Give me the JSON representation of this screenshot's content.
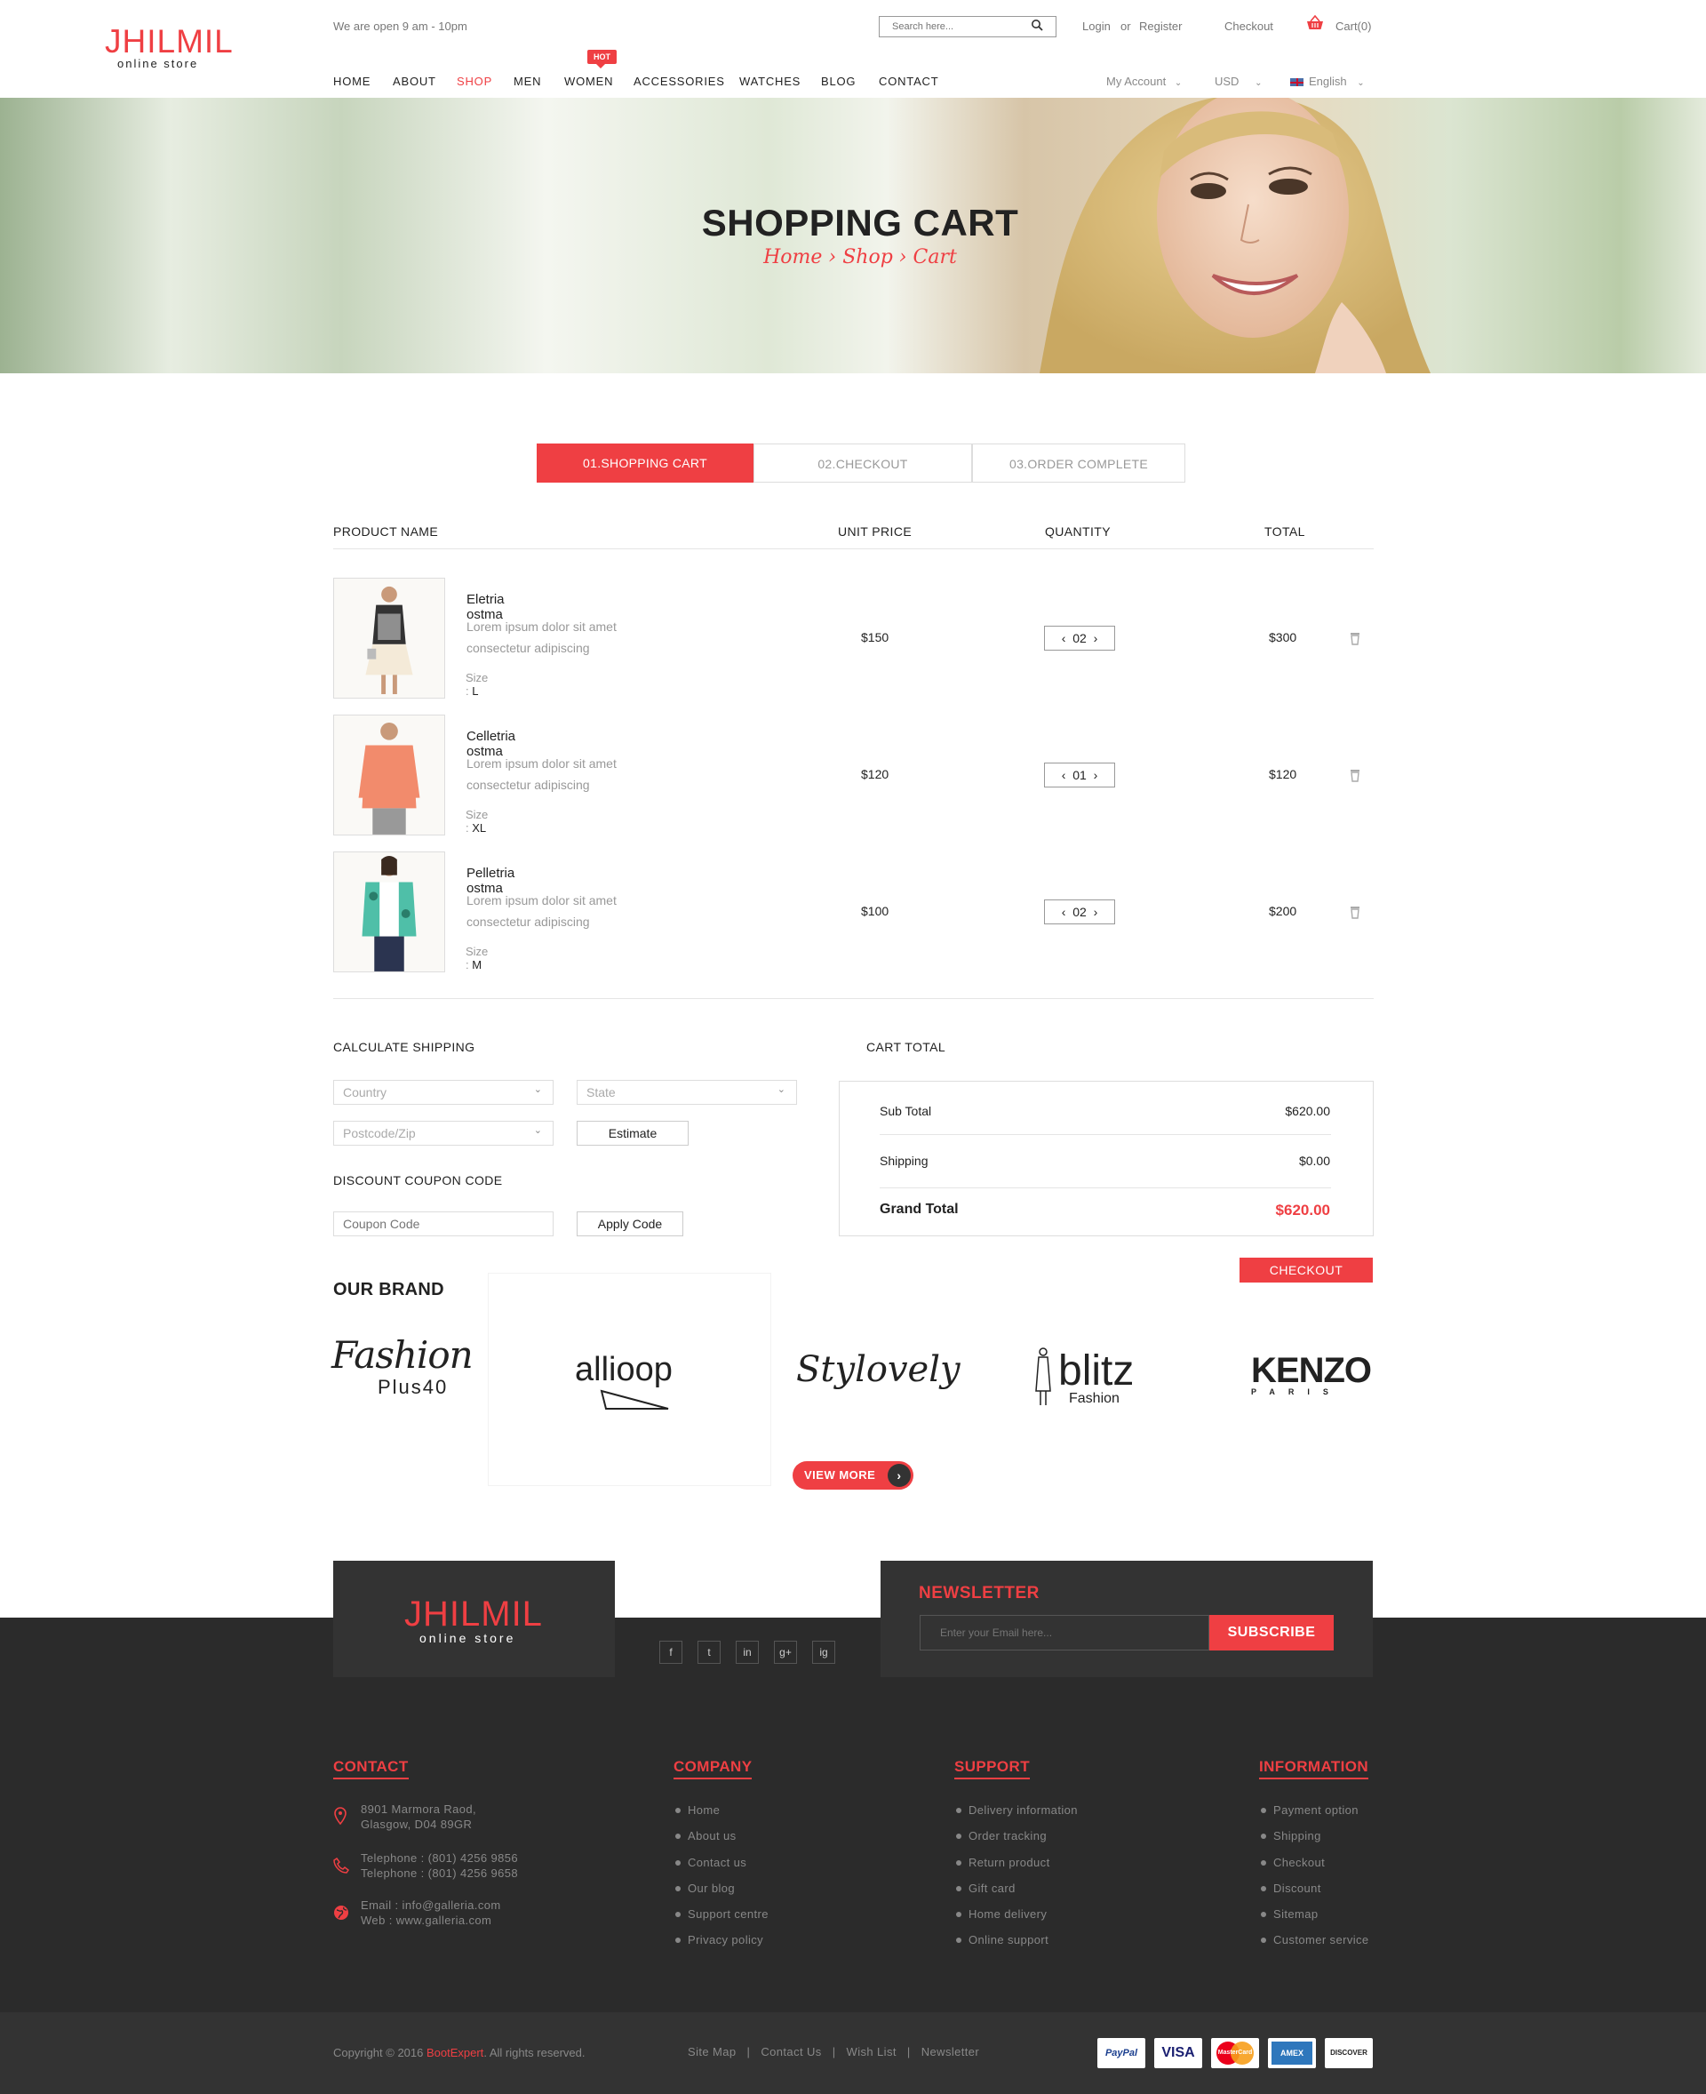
{
  "header": {
    "logo_main": "JHILMIL",
    "logo_sub": "online store",
    "open_hours": "We are open 9 am - 10pm",
    "search_placeholder": "Search here...",
    "login": "Login",
    "or": "or",
    "register": "Register",
    "checkout": "Checkout",
    "cart": "Cart(0)",
    "hot_badge": "HOT",
    "nav": [
      "HOME",
      "ABOUT",
      "SHOP",
      "MEN",
      "WOMEN",
      "ACCESSORIES",
      "WATCHES",
      "BLOG",
      "CONTACT"
    ],
    "my_account": "My Account",
    "currency": "USD",
    "language": "English"
  },
  "banner": {
    "title": "SHOPPING CART",
    "breadcrumb": "Home › Shop › Cart"
  },
  "steps": [
    "01.SHOPPING CART",
    "02.CHECKOUT",
    "03.ORDER COMPLETE"
  ],
  "table": {
    "headers": [
      "PRODUCT NAME",
      "UNIT PRICE",
      "QUANTITY",
      "TOTAL"
    ],
    "rows": [
      {
        "name": "Eletria ostma",
        "desc": "Lorem ipsum dolor sit amet consectetur adipiscing",
        "size_label": "Size :",
        "size": "L",
        "price": "$150",
        "qty": "02",
        "total": "$300"
      },
      {
        "name": "Celletria ostma",
        "desc": "Lorem ipsum dolor sit amet consectetur adipiscing",
        "size_label": "Size :",
        "size": "XL",
        "price": "$120",
        "qty": "01",
        "total": "$120"
      },
      {
        "name": "Pelletria ostma",
        "desc": "Lorem ipsum dolor sit amet consectetur adipiscing",
        "size_label": "Size :",
        "size": "M",
        "price": "$100",
        "qty": "02",
        "total": "$200"
      }
    ]
  },
  "shipping": {
    "title": "CALCULATE SHIPPING",
    "country": "Country",
    "state": "State",
    "postcode": "Postcode/Zip",
    "estimate": "Estimate",
    "coupon_title": "DISCOUNT COUPON CODE",
    "coupon_placeholder": "Coupon Code",
    "apply": "Apply Code"
  },
  "cart_total": {
    "title": "CART TOTAL",
    "subtotal_label": "Sub Total",
    "subtotal": "$620.00",
    "shipping_label": "Shipping",
    "shipping": "$0.00",
    "grand_label": "Grand Total",
    "grand": "$620.00",
    "checkout_btn": "CHECKOUT"
  },
  "brands": {
    "title": "OUR BRAND",
    "items": [
      "Fashion",
      "Plus40",
      "allioop",
      "Stylovely",
      "blitz",
      "Fashion",
      "KENZO",
      "PARIS"
    ],
    "view_more": "VIEW MORE"
  },
  "footer": {
    "logo_main": "JHILMIL",
    "logo_sub": "online store",
    "newsletter_title": "NEWSLETTER",
    "newsletter_placeholder": "Enter your Email here...",
    "subscribe": "SUBSCRIBE",
    "social": [
      "f",
      "t",
      "in",
      "g+",
      "ig"
    ],
    "contact_title": "CONTACT",
    "address1": "8901 Marmora Raod,",
    "address2": "Glasgow, D04 89GR",
    "phone1": "Telephone : (801) 4256 9856",
    "phone2": "Telephone : (801) 4256 9658",
    "email": "Email : info@galleria.com",
    "web": "Web : www.galleria.com",
    "company_title": "COMPANY",
    "company": [
      "Home",
      "About us",
      "Contact us",
      "Our blog",
      "Support centre",
      "Privacy policy"
    ],
    "support_title": "SUPPORT",
    "support": [
      "Delivery information",
      "Order tracking",
      "Return product",
      "Gift card",
      "Home delivery",
      "Online support"
    ],
    "info_title": "INFORMATION",
    "info": [
      "Payment option",
      "Shipping",
      "Checkout",
      "Discount",
      "Sitemap",
      "Customer service"
    ],
    "copyright_pre": "Copyright © 2016",
    "copyright_brand": "BootExpert",
    "copyright_post": ". All rights reserved.",
    "bottom_links": [
      "Site Map",
      "Contact Us",
      "Wish List",
      "Newsletter"
    ],
    "payments": [
      "PayPal",
      "VISA",
      "MasterCard",
      "AMEX",
      "DISCOVER"
    ]
  },
  "colors": {
    "accent": "#ef3f43",
    "footer": "#2b2b2b"
  }
}
